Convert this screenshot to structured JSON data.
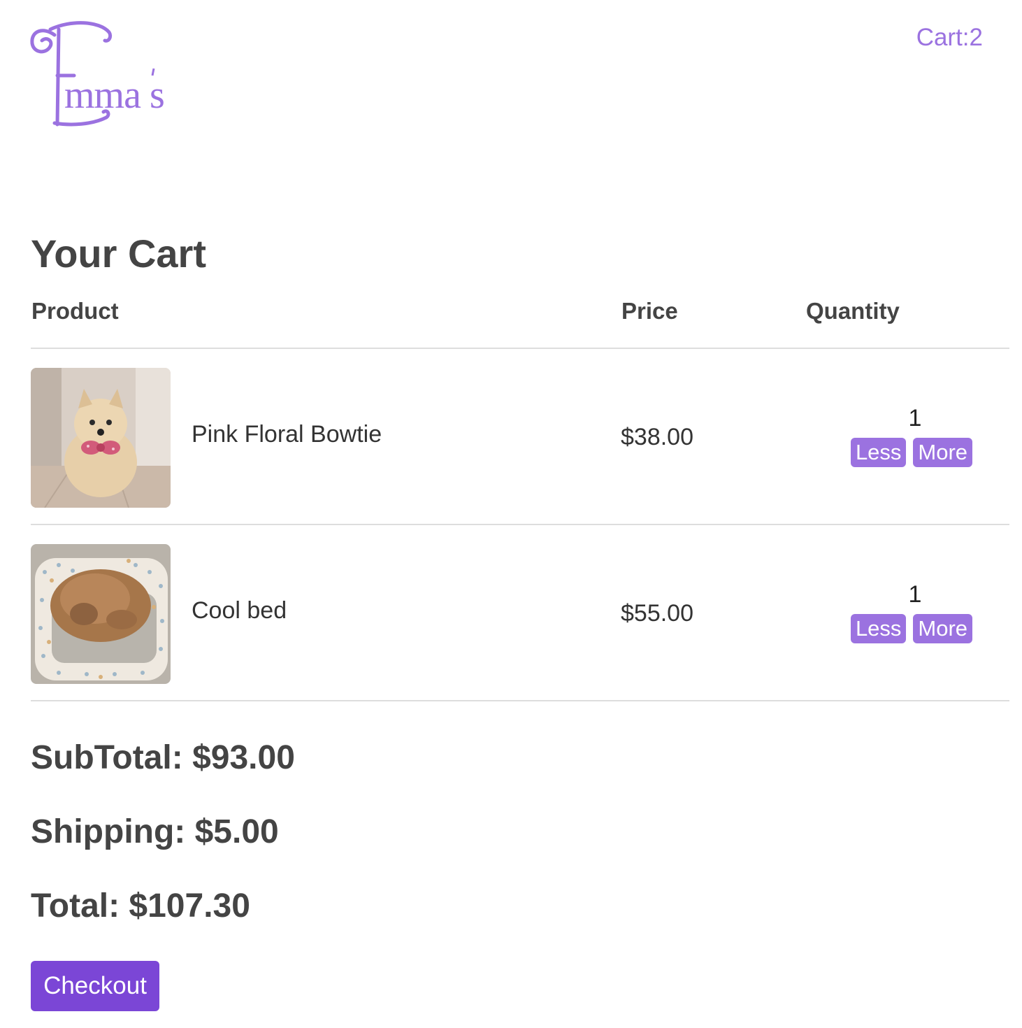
{
  "header": {
    "logo_alt": "Emma's",
    "cart_label": "Cart:2"
  },
  "cart": {
    "title": "Your Cart",
    "columns": {
      "product": "Product",
      "price": "Price",
      "quantity": "Quantity"
    },
    "items": [
      {
        "name": "Pink Floral Bowtie",
        "price": "$38.00",
        "quantity": "1",
        "less_label": "Less",
        "more_label": "More",
        "image_description": "pomeranian-with-bowtie"
      },
      {
        "name": "Cool bed",
        "price": "$55.00",
        "quantity": "1",
        "less_label": "Less",
        "more_label": "More",
        "image_description": "pomeranian-in-dotted-bed"
      }
    ]
  },
  "summary": {
    "subtotal": "SubTotal: $93.00",
    "shipping": "Shipping: $5.00",
    "total": "Total: $107.30",
    "checkout_label": "Checkout"
  },
  "colors": {
    "brand": "#9b72e0",
    "checkout": "#7b46d6",
    "text": "#444444"
  }
}
